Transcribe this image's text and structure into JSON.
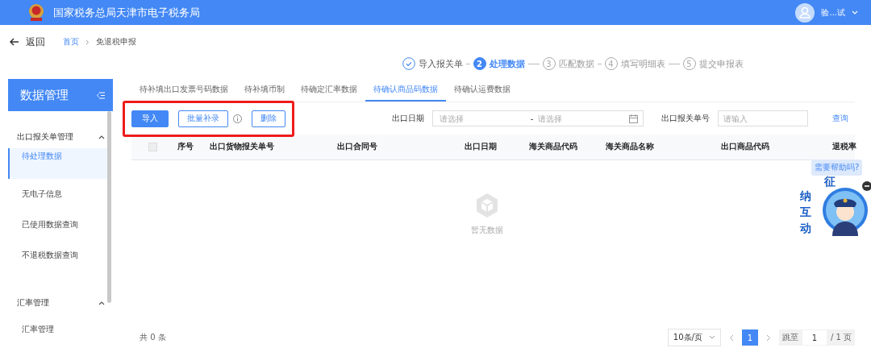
{
  "header": {
    "title": "国家税务总局天津市电子税务局",
    "user": "验...试"
  },
  "nav": {
    "back": "返回",
    "breadcrumb": [
      {
        "label": "首页",
        "link": true
      },
      {
        "label": "免退税申报",
        "link": false
      }
    ]
  },
  "steps": [
    {
      "label": "导入报关单",
      "done": true,
      "current": false
    },
    {
      "label": "处理数据",
      "number": "2",
      "done": false,
      "current": true
    },
    {
      "label": "匹配数据",
      "number": "3",
      "done": false,
      "current": false
    },
    {
      "label": "填写明细表",
      "number": "4",
      "done": false,
      "current": false
    },
    {
      "label": "提交申报表",
      "number": "5",
      "done": false,
      "current": false
    }
  ],
  "sidebar": {
    "title": "数据管理",
    "groups": [
      {
        "label": "出口报关单管理",
        "expanded": true,
        "children": [
          {
            "label": "待处理数据",
            "selected": true
          },
          {
            "label": "无电子信息",
            "selected": false
          },
          {
            "label": "已使用数据查询",
            "selected": false
          },
          {
            "label": "不退税数据查询",
            "selected": false
          }
        ]
      },
      {
        "label": "汇率管理",
        "expanded": true,
        "children": [
          {
            "label": "汇率管理",
            "selected": false
          }
        ]
      }
    ]
  },
  "tabs": [
    {
      "label": "待补填出口发票号码数据",
      "selected": false
    },
    {
      "label": "待补填币制",
      "selected": false
    },
    {
      "label": "待确定汇率数据",
      "selected": false
    },
    {
      "label": "待确认商品码数据",
      "selected": true
    },
    {
      "label": "待确认运费数据",
      "selected": false
    }
  ],
  "toolbar": {
    "highlighted": true,
    "buttons": [
      {
        "label": "导入",
        "kind": "primary"
      },
      {
        "label": "批量补录",
        "kind": "outline"
      },
      {
        "kind": "info"
      },
      {
        "label": "删除",
        "kind": "outline"
      }
    ]
  },
  "filters": {
    "date_label": "出口日期",
    "date_start": {
      "placeholder": "请选择"
    },
    "date_sep": "-",
    "date_end": {
      "placeholder": "请选择"
    },
    "number_label": "出口报关单号",
    "number": {
      "placeholder": "请输入"
    },
    "query": "查询"
  },
  "table": {
    "select_all": {
      "checked": false
    },
    "columns": [
      "序号",
      "出口货物报关单号",
      "出口合同号",
      "出口日期",
      "海关商品代码",
      "海关商品名称",
      "出口商品代码",
      "退税率"
    ],
    "empty_text": "暂无数据"
  },
  "pagination": {
    "total": "共 0 条",
    "page_size": "10条/页",
    "pages": [
      {
        "label": "1",
        "selected": true
      }
    ],
    "jump_label": "跳至",
    "jump_value": "1",
    "page_count": "/ 1 页"
  },
  "assistant": {
    "bubble": "需要帮助吗?",
    "title": [
      "征",
      "纳",
      "互",
      "动"
    ]
  }
}
